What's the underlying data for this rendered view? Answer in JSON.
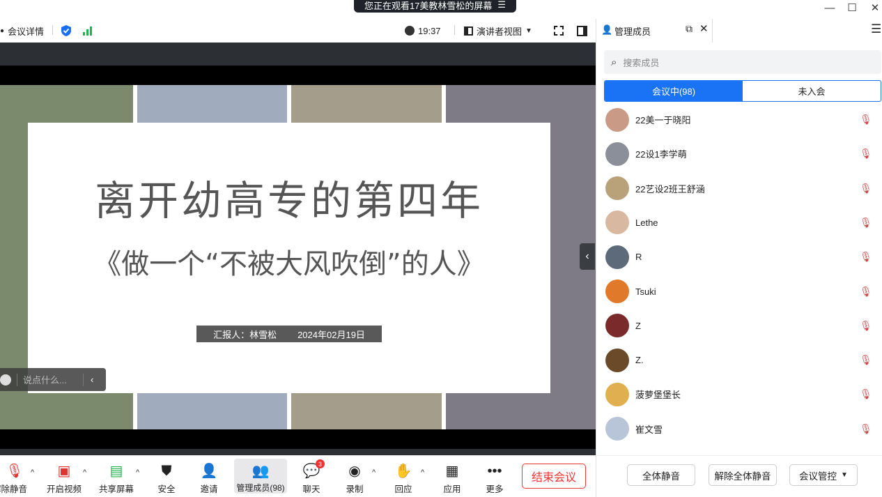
{
  "window": {
    "banner_text": "您正在观看17美教林雪松的屏幕",
    "banner_icon": "menu-lines-icon",
    "min_icon": "—",
    "max_icon": "☐",
    "close_icon": "✕"
  },
  "topbar": {
    "meeting_details": "会议详情",
    "time": "19:37",
    "view_mode": "演讲者视图"
  },
  "slide": {
    "title": "离开幼高专的第四年",
    "subtitle": "《做一个“不被大风吹倒”的人》",
    "reporter": "汇报人：林雪松",
    "date": "2024年02月19日"
  },
  "chat_input": {
    "placeholder": "说点什么..."
  },
  "bottombar": {
    "unmute": "解除静音",
    "video": "开启视频",
    "share": "共享屏幕",
    "security": "安全",
    "invite": "邀请",
    "members": "管理成员(98)",
    "chat": "聊天",
    "chat_badge": "3",
    "record": "录制",
    "react": "回应",
    "apps": "应用",
    "more": "更多",
    "end": "结束会议"
  },
  "panel": {
    "title": "管理成员",
    "search_placeholder": "搜索成员",
    "tab_in": "会议中(98)",
    "tab_out": "未入会",
    "members": [
      {
        "name": "22美一于晓阳",
        "color": "#c99a86"
      },
      {
        "name": "22设1李学萌",
        "color": "#8a8f99"
      },
      {
        "name": "22艺设2班王舒涵",
        "color": "#b9a27a"
      },
      {
        "name": "Lethe",
        "color": "#d8b8a0"
      },
      {
        "name": "R",
        "color": "#5d6a7a"
      },
      {
        "name": "Tsuki",
        "color": "#e07a2a"
      },
      {
        "name": "Z",
        "color": "#7a2a2a"
      },
      {
        "name": "Z.",
        "color": "#6b4a2a"
      },
      {
        "name": "菠萝堡堡长",
        "color": "#e0b050"
      },
      {
        "name": "崔文雪",
        "color": "#b8c4d8"
      }
    ],
    "mute_all": "全体静音",
    "unmute_all": "解除全体静音",
    "controls": "会议管控"
  }
}
